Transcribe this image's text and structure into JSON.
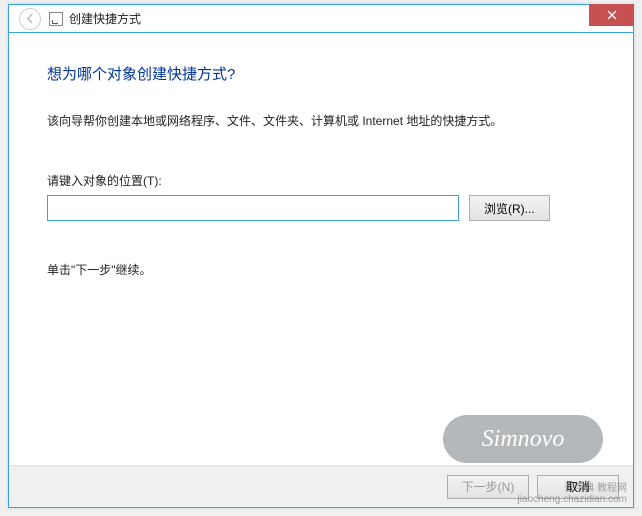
{
  "titlebar": {
    "title": "创建快捷方式"
  },
  "content": {
    "heading": "想为哪个对象创建快捷方式?",
    "description": "该向导帮你创建本地或网络程序、文件、文件夹、计算机或 Internet 地址的快捷方式。",
    "location_label": "请键入对象的位置(T):",
    "location_value": "",
    "browse_label": "浏览(R)...",
    "hint": "单击\"下一步\"继续。"
  },
  "footer": {
    "next_label": "下一步(N)",
    "cancel_label": "取消"
  },
  "watermark": {
    "main": "Simnovo",
    "corner_line1": "查字典  教程网",
    "corner_line2": "jiaocheng.chazidian.com"
  }
}
